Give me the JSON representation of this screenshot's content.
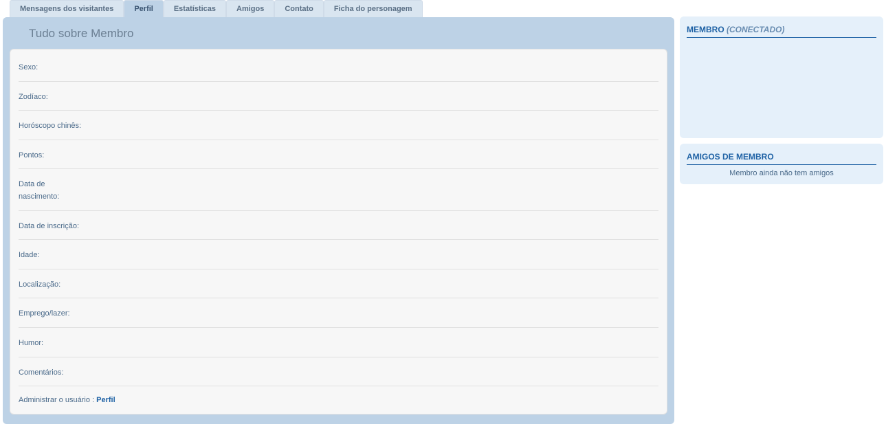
{
  "tabs": [
    {
      "label": "Mensagens dos visitantes"
    },
    {
      "label": "Perfil"
    },
    {
      "label": "Estatísticas"
    },
    {
      "label": "Amigos"
    },
    {
      "label": "Contato"
    },
    {
      "label": "Ficha do personagem"
    }
  ],
  "main": {
    "title": "Tudo sobre Membro",
    "fields": {
      "sexo": "Sexo:",
      "zodiaco": "Zodíaco:",
      "chines": "Horóscopo chinês:",
      "pontos": "Pontos:",
      "nascimento": "Data de nascimento:",
      "inscricao": "Data de inscrição:",
      "idade": "Idade:",
      "local": "Localização:",
      "emprego": "Emprego/lazer:",
      "humor": "Humor:",
      "comentarios": "Comentários:"
    },
    "admin_prefix": "Administrar o usuário : ",
    "admin_link": "Perfil"
  },
  "sidebar": {
    "member_title": "MEMBRO ",
    "member_status": "(CONECTADO)",
    "friends_title": "AMIGOS DE MEMBRO",
    "friends_empty": "Membro ainda não tem amigos"
  }
}
